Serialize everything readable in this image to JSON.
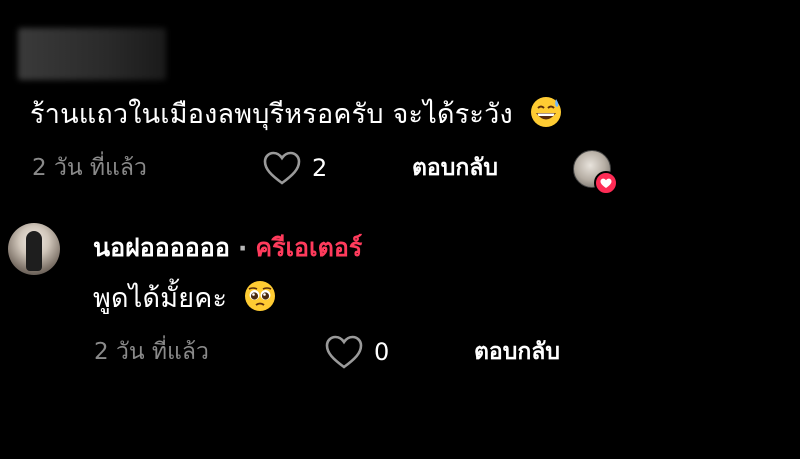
{
  "comments": [
    {
      "text": "ร้านแถวในเมืองลพบุรีหรอครับ จะได้ระวัง",
      "emoji": "grinning-sweat-emoji",
      "timestamp": "2 วัน ที่แล้ว",
      "likes": "2",
      "reply_label": "ตอบกลับ"
    },
    {
      "username": "นอฝออออออ",
      "separator": "·",
      "creator_tag": "ครีเอเตอร์",
      "text": "พูดได้มั้ยคะ",
      "emoji": "pleading-face-emoji",
      "timestamp": "2 วัน ที่แล้ว",
      "likes": "0",
      "reply_label": "ตอบกลับ"
    }
  ],
  "colors": {
    "background": "#000000",
    "primary_text": "#ffffff",
    "secondary_text": "#8a8a8a",
    "creator_accent": "#ff3b5c",
    "like_badge": "#fe2c55"
  }
}
